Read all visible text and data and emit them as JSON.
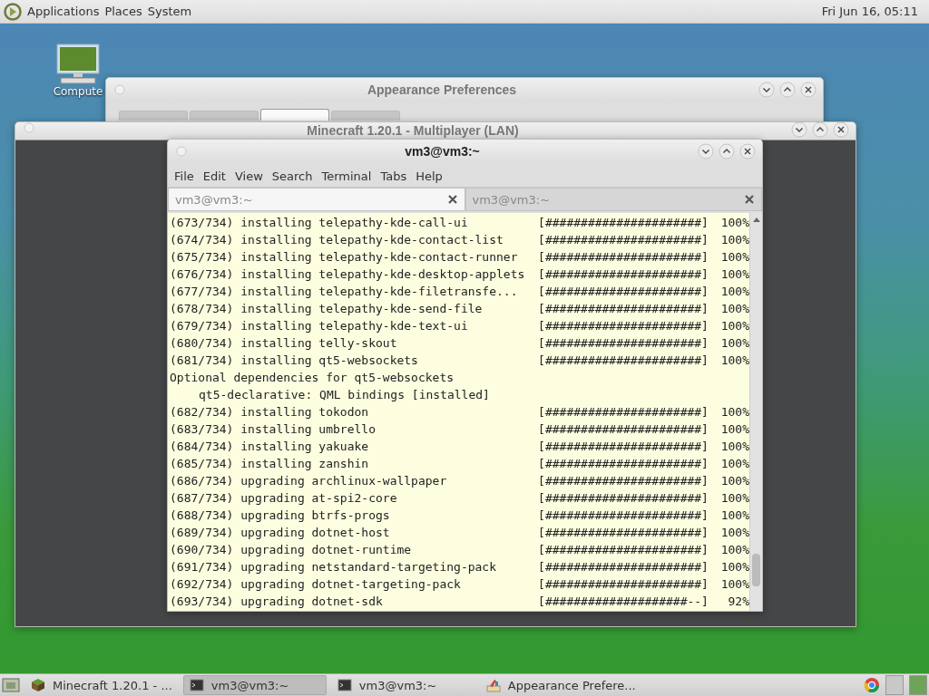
{
  "top_panel": {
    "menus": [
      "Applications",
      "Places",
      "System"
    ],
    "clock": "Fri Jun 16, 05:11"
  },
  "desktop_icons": [
    {
      "label": "Compute"
    }
  ],
  "windows": [
    {
      "kind": "appearance",
      "title": "Appearance Preferences",
      "tabs": [
        {
          "selected": false
        },
        {
          "selected": false
        },
        {
          "selected": true
        },
        {
          "selected": false
        }
      ]
    },
    {
      "kind": "minecraft",
      "title": "Minecraft 1.20.1 - Multiplayer (LAN)"
    },
    {
      "kind": "terminal",
      "title": "vm3@vm3:~",
      "menu": [
        "File",
        "Edit",
        "View",
        "Search",
        "Terminal",
        "Tabs",
        "Help"
      ],
      "tabs": [
        {
          "label": "vm3@vm3:~",
          "selected": true
        },
        {
          "label": "vm3@vm3:~",
          "selected": false
        }
      ],
      "lines": [
        {
          "kind": "progress",
          "text": "(673/734) installing telepathy-kde-call-ui",
          "bar": "[######################]",
          "percent": "100%"
        },
        {
          "kind": "progress",
          "text": "(674/734) installing telepathy-kde-contact-list",
          "bar": "[######################]",
          "percent": "100%"
        },
        {
          "kind": "progress",
          "text": "(675/734) installing telepathy-kde-contact-runner",
          "bar": "[######################]",
          "percent": "100%"
        },
        {
          "kind": "progress",
          "text": "(676/734) installing telepathy-kde-desktop-applets",
          "bar": "[######################]",
          "percent": "100%"
        },
        {
          "kind": "progress",
          "text": "(677/734) installing telepathy-kde-filetransfe...",
          "bar": "[######################]",
          "percent": "100%"
        },
        {
          "kind": "progress",
          "text": "(678/734) installing telepathy-kde-send-file",
          "bar": "[######################]",
          "percent": "100%"
        },
        {
          "kind": "progress",
          "text": "(679/734) installing telepathy-kde-text-ui",
          "bar": "[######################]",
          "percent": "100%"
        },
        {
          "kind": "progress",
          "text": "(680/734) installing telly-skout",
          "bar": "[######################]",
          "percent": "100%"
        },
        {
          "kind": "progress",
          "text": "(681/734) installing qt5-websockets",
          "bar": "[######################]",
          "percent": "100%"
        },
        {
          "kind": "message",
          "text": "Optional dependencies for qt5-websockets"
        },
        {
          "kind": "detail",
          "text": "qt5-declarative: QML bindings [installed]"
        },
        {
          "kind": "progress",
          "text": "(682/734) installing tokodon",
          "bar": "[######################]",
          "percent": "100%"
        },
        {
          "kind": "progress",
          "text": "(683/734) installing umbrello",
          "bar": "[######################]",
          "percent": "100%"
        },
        {
          "kind": "progress",
          "text": "(684/734) installing yakuake",
          "bar": "[######################]",
          "percent": "100%"
        },
        {
          "kind": "progress",
          "text": "(685/734) installing zanshin",
          "bar": "[######################]",
          "percent": "100%"
        },
        {
          "kind": "progress",
          "text": "(686/734) upgrading archlinux-wallpaper",
          "bar": "[######################]",
          "percent": "100%"
        },
        {
          "kind": "progress",
          "text": "(687/734) upgrading at-spi2-core",
          "bar": "[######################]",
          "percent": "100%"
        },
        {
          "kind": "progress",
          "text": "(688/734) upgrading btrfs-progs",
          "bar": "[######################]",
          "percent": "100%"
        },
        {
          "kind": "progress",
          "text": "(689/734) upgrading dotnet-host",
          "bar": "[######################]",
          "percent": "100%"
        },
        {
          "kind": "progress",
          "text": "(690/734) upgrading dotnet-runtime",
          "bar": "[######################]",
          "percent": "100%"
        },
        {
          "kind": "progress",
          "text": "(691/734) upgrading netstandard-targeting-pack",
          "bar": "[######################]",
          "percent": "100%"
        },
        {
          "kind": "progress",
          "text": "(692/734) upgrading dotnet-targeting-pack",
          "bar": "[######################]",
          "percent": "100%"
        },
        {
          "kind": "progress",
          "text": "(693/734) upgrading dotnet-sdk",
          "bar": "[####################--]",
          "percent": "92%"
        }
      ]
    }
  ],
  "taskbar": [
    {
      "kind": "minecraft",
      "label": "Minecraft 1.20.1 - ...",
      "selected": false
    },
    {
      "kind": "terminal",
      "label": "vm3@vm3:~",
      "selected": true
    },
    {
      "kind": "terminal",
      "label": "vm3@vm3:~",
      "selected": false
    },
    {
      "kind": "appearance",
      "label": "Appearance Prefere...",
      "selected": false
    }
  ]
}
